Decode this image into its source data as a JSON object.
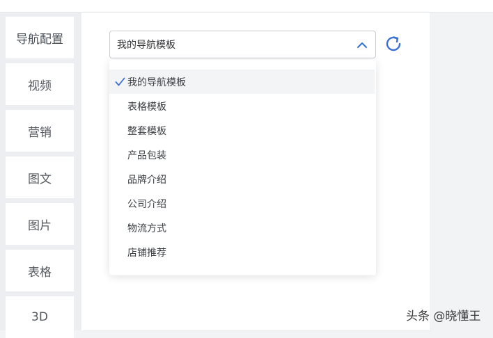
{
  "sidebar": {
    "items": [
      {
        "label": "导航配置"
      },
      {
        "label": "视频"
      },
      {
        "label": "营销"
      },
      {
        "label": "图文"
      },
      {
        "label": "图片"
      },
      {
        "label": "表格"
      },
      {
        "label": "3D"
      }
    ]
  },
  "template_select": {
    "value": "我的导航模板",
    "expanded": true,
    "options": [
      {
        "label": "我的导航模板",
        "selected": true
      },
      {
        "label": "表格模板",
        "selected": false
      },
      {
        "label": "整套模板",
        "selected": false
      },
      {
        "label": "产品包装",
        "selected": false
      },
      {
        "label": "品牌介绍",
        "selected": false
      },
      {
        "label": "公司介绍",
        "selected": false
      },
      {
        "label": "物流方式",
        "selected": false
      },
      {
        "label": "店铺推荐",
        "selected": false
      }
    ]
  },
  "icons": {
    "chevron": "chevron-up-icon",
    "refresh": "refresh-icon",
    "check": "check-icon"
  },
  "colors": {
    "accent": "#3b6fd4",
    "chevron": "#2f6fd0"
  },
  "watermark": {
    "text": "头条 @晓懂王"
  }
}
